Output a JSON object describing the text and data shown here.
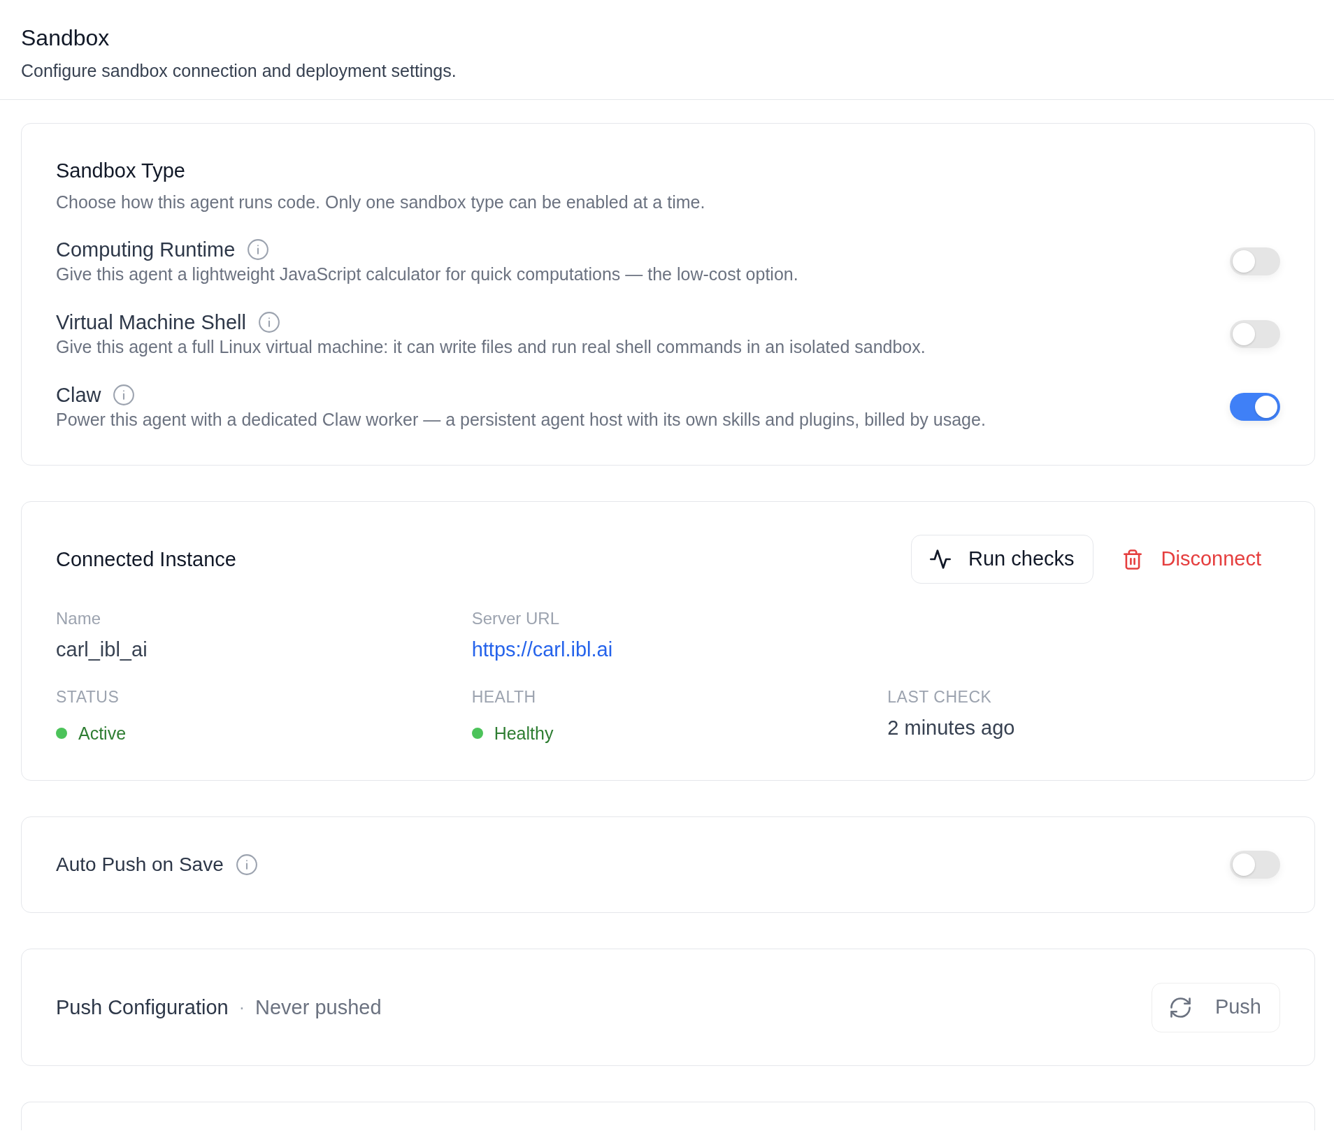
{
  "header": {
    "title": "Sandbox",
    "description": "Configure sandbox connection and deployment settings."
  },
  "sandbox_type": {
    "title": "Sandbox Type",
    "description": "Choose how this agent runs code. Only one sandbox type can be enabled at a time.",
    "options": [
      {
        "title": "Computing Runtime",
        "description": "Give this agent a lightweight JavaScript calculator for quick computations — the low-cost option.",
        "on": false
      },
      {
        "title": "Virtual Machine Shell",
        "description": "Give this agent a full Linux virtual machine: it can write files and run real shell commands in an isolated sandbox.",
        "on": false
      },
      {
        "title": "Claw",
        "description": "Power this agent with a dedicated Claw worker — a persistent agent host with its own skills and plugins, billed by usage.",
        "on": true
      }
    ]
  },
  "connected_instance": {
    "title": "Connected Instance",
    "buttons": [
      {
        "kind": "checks",
        "label": "Run checks"
      },
      {
        "kind": "danger",
        "label": "Disconnect"
      }
    ],
    "fields": [
      {
        "kind": "text",
        "label": "Name",
        "value": "carl_ibl_ai"
      },
      {
        "kind": "link",
        "label": "Server URL",
        "value": "https://carl.ibl.ai"
      }
    ],
    "indicators": [
      {
        "kind": "status",
        "label": "STATUS",
        "value": "Active",
        "color": "#4cc35a"
      },
      {
        "kind": "status",
        "label": "HEALTH",
        "value": "Healthy",
        "color": "#4cc35a"
      },
      {
        "kind": "text",
        "label": "LAST CHECK",
        "value": "2 minutes ago"
      }
    ]
  },
  "auto_push": {
    "title": "Auto Push on Save",
    "on": false
  },
  "push_configuration": {
    "title": "Push Configuration",
    "separator": "·",
    "status": "Never pushed",
    "button": {
      "label": "Push",
      "disabled": true
    }
  }
}
